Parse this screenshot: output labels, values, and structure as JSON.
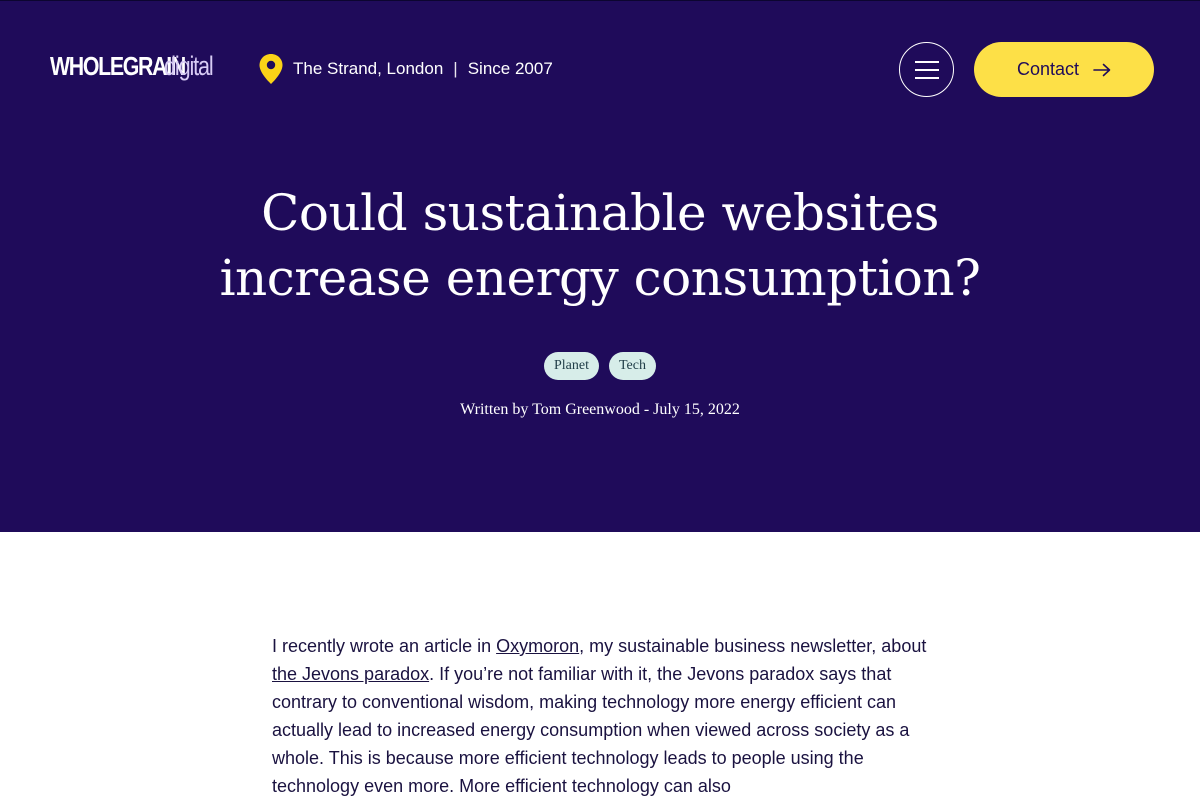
{
  "header": {
    "logo": {
      "bold": "WHOLEGRAIN",
      "light": "digital"
    },
    "location": {
      "place": "The Strand, London",
      "separator": "|",
      "since": "Since 2007",
      "pin_color": "#fbd317"
    },
    "menu_icon": "hamburger-icon",
    "contact": {
      "label": "Contact",
      "icon": "arrow-right-icon"
    }
  },
  "hero": {
    "background": "#1f0b5a",
    "title": "Could sustainable websites increase energy consumption?",
    "tags": [
      {
        "label": "Planet"
      },
      {
        "label": "Tech"
      }
    ],
    "byline": "Written by Tom Greenwood - July 15, 2022"
  },
  "article": {
    "p1": {
      "t1": "I recently wrote an article in ",
      "link1": "Oxymoron",
      "t2": ", my sustainable business newsletter, about ",
      "link2": "the Jevons paradox",
      "t3": ". If you’re not familiar with it, the Jevons paradox says that contrary to conventional wisdom, making technology more energy efficient can actually lead to increased energy consumption when viewed across society as a whole. This is because more efficient technology leads to people using the technology even more. More efficient technology can also"
    }
  },
  "colors": {
    "accent_yellow": "#fde047",
    "tag_bg": "#d7ede9",
    "text_dark": "#1a1240"
  }
}
